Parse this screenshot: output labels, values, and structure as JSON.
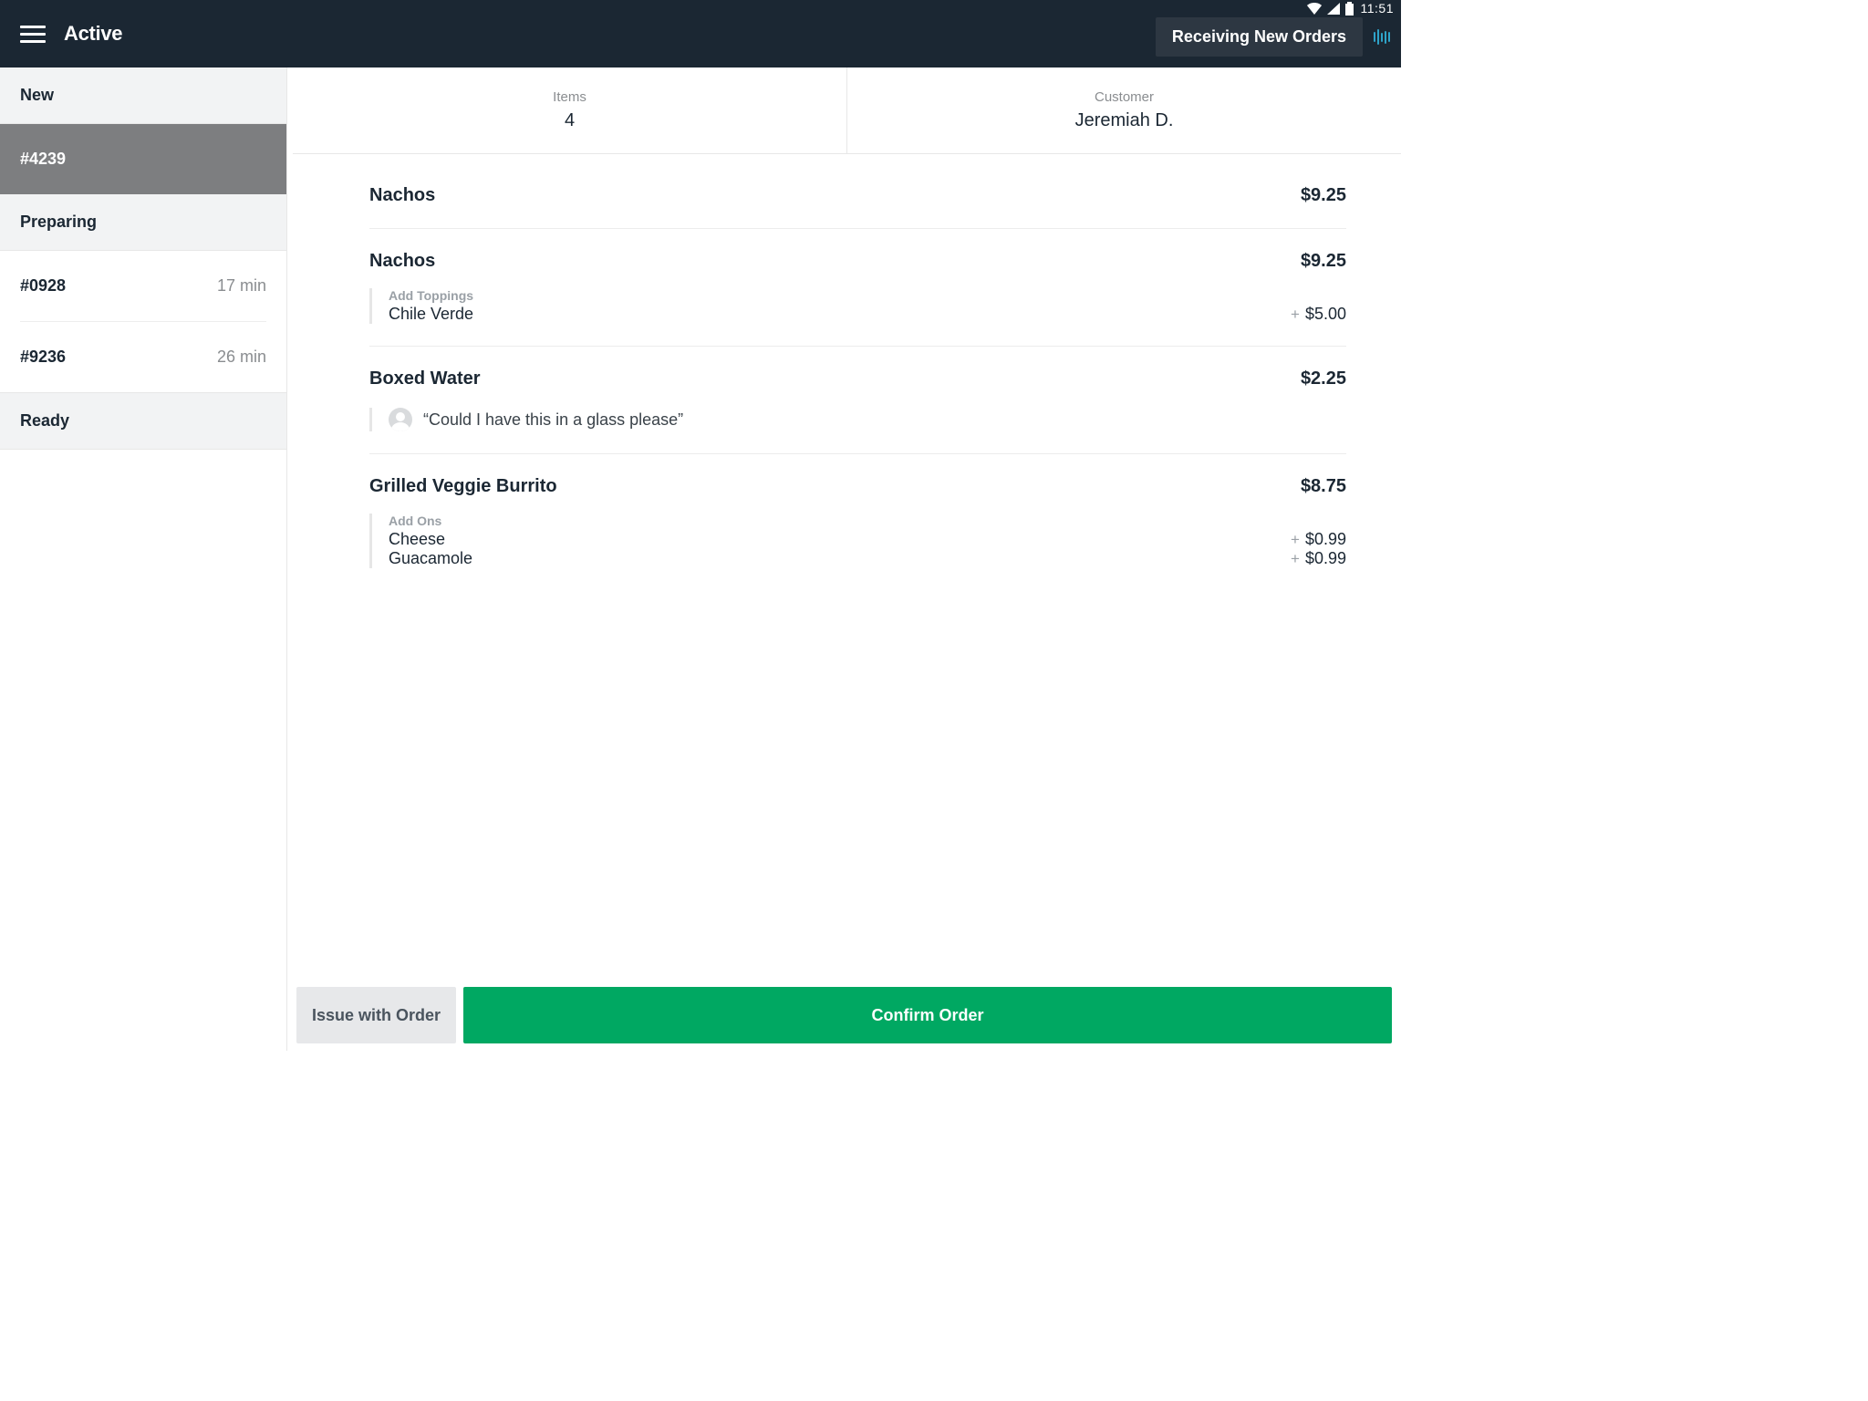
{
  "status_bar": {
    "time": "11:51"
  },
  "header": {
    "title": "Active",
    "status_badge": "Receiving New Orders"
  },
  "sidebar": {
    "sections": {
      "new": {
        "label": "New",
        "orders": [
          {
            "id": "#4239",
            "selected": true
          }
        ]
      },
      "preparing": {
        "label": "Preparing",
        "orders": [
          {
            "id": "#0928",
            "time": "17 min"
          },
          {
            "id": "#9236",
            "time": "26 min"
          }
        ]
      },
      "ready": {
        "label": "Ready"
      }
    }
  },
  "order": {
    "items_label": "Items",
    "items_count": "4",
    "customer_label": "Customer",
    "customer_name": "Jeremiah D.",
    "lines": [
      {
        "name": "Nachos",
        "price": "$9.25"
      },
      {
        "name": "Nachos",
        "price": "$9.25",
        "mod_group": "Add Toppings",
        "mods": [
          {
            "name": "Chile Verde",
            "price": "$5.00"
          }
        ]
      },
      {
        "name": "Boxed Water",
        "price": "$2.25",
        "note": "“Could I have this in a glass please”"
      },
      {
        "name": "Grilled Veggie Burrito",
        "price": "$8.75",
        "mod_group": "Add Ons",
        "mods": [
          {
            "name": "Cheese",
            "price": "$0.99"
          },
          {
            "name": "Guacamole",
            "price": "$0.99"
          }
        ]
      }
    ]
  },
  "footer": {
    "issue_label": "Issue with Order",
    "confirm_label": "Confirm Order"
  }
}
